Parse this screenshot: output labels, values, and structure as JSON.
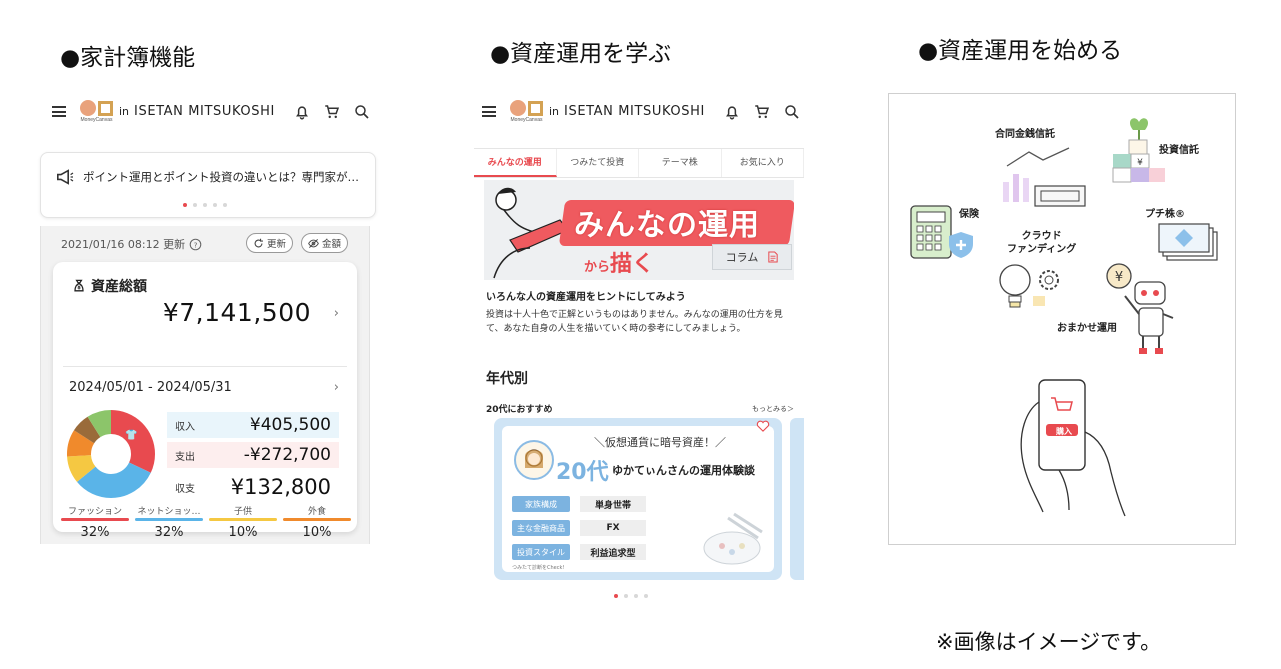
{
  "headings": {
    "household": "●家計簿機能",
    "learn": "●資産運用を学ぶ",
    "start": "●資産運用を始める"
  },
  "footnote": "※画像はイメージです。",
  "header": {
    "logo_sub": "MoneyCanvas",
    "in_label": "in",
    "brand": "ISETAN MITSUKOSHI",
    "icons": [
      "menu-icon",
      "bell-icon",
      "cart-icon",
      "search-icon"
    ]
  },
  "household": {
    "notice": "ポイント運用とポイント投資の違いとは？専門家が…",
    "updated": "2021/01/16 08:12 更新",
    "refresh_label": "更新",
    "amount_label": "金額",
    "assets_title": "資産総額",
    "assets_amount": "¥7,141,500",
    "period": "2024/05/01 - 2024/05/31",
    "income_label": "収入",
    "income": "¥405,500",
    "expense_label": "支出",
    "expense": "-¥272,700",
    "balance_label": "収支",
    "balance": "¥132,800",
    "categories": [
      {
        "label": "ファッション",
        "value": "32%",
        "color": "#e84a4f"
      },
      {
        "label": "ネットショッ…",
        "value": "32%",
        "color": "#5ab4e8"
      },
      {
        "label": "子供",
        "value": "10%",
        "color": "#f5c842"
      },
      {
        "label": "外食",
        "value": "10%",
        "color": "#f08a2c"
      }
    ]
  },
  "learn": {
    "tabs": [
      "みんなの運用",
      "つみたて投資",
      "テーマ株",
      "お気に入り"
    ],
    "banner_title": "みんなの運用",
    "banner_sub_small": "から",
    "banner_sub": "描く",
    "column_label": "コラム",
    "lead": "いろんな人の資産運用をヒントにしてみよう",
    "lead_body": "投資は十人十色で正解というものはありません。みんなの運用の仕方を見て、あなた自身の人生を描いていく時の参考にしてみましょう。",
    "section": "年代別",
    "sub": "20代におすすめ",
    "more": "もっとみる＞",
    "card": {
      "kicker": "＼仮想通貨に暗号資産！／",
      "age": "20代",
      "title": "ゆかてぃんさんの運用体験談",
      "rows": [
        {
          "label": "家族構成",
          "value": "単身世帯"
        },
        {
          "label": "主な金融商品",
          "value": "FX"
        },
        {
          "label": "投資スタイル",
          "value": "利益追求型"
        }
      ],
      "note": "つみたて診断をCheck!"
    }
  },
  "start": {
    "labels": {
      "mutual": "合同金銭信託",
      "fund": "投資信託",
      "insurance": "保険",
      "petit": "プチ株®",
      "crowd": "クラウド\nファンディング",
      "robo": "おまかせ運用",
      "buy": "購入"
    }
  }
}
